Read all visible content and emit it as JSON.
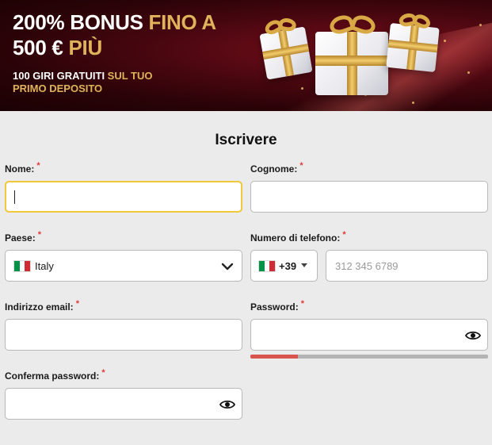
{
  "banner": {
    "headline_line1_white": "200% BONUS ",
    "headline_line1_gold": "FINO A",
    "headline_line2_white": "500 € ",
    "headline_line2_gold": "PIÙ",
    "sub_white": "100 GIRI GRATUITI ",
    "sub_gold": "SUL TUO PRIMO DEPOSITO"
  },
  "form": {
    "title": "Iscrivere",
    "required_mark": "*",
    "first_name": {
      "label": "Nome:",
      "value": ""
    },
    "last_name": {
      "label": "Cognome:",
      "value": ""
    },
    "country": {
      "label": "Paese:",
      "value": "Italy",
      "flag": "italy-flag-icon"
    },
    "phone": {
      "label": "Numero di telefono:",
      "code": "+39",
      "placeholder": "312 345 6789"
    },
    "email": {
      "label": "Indirizzo email:",
      "value": ""
    },
    "password": {
      "label": "Password:",
      "value": "",
      "strength": 0.2
    },
    "confirm_password": {
      "label": "Conferma password:",
      "value": ""
    }
  },
  "colors": {
    "gold": "#e0b35a",
    "required": "#e03a3a",
    "active_border": "#f0c83a",
    "strength_weak": "#d9534f"
  }
}
